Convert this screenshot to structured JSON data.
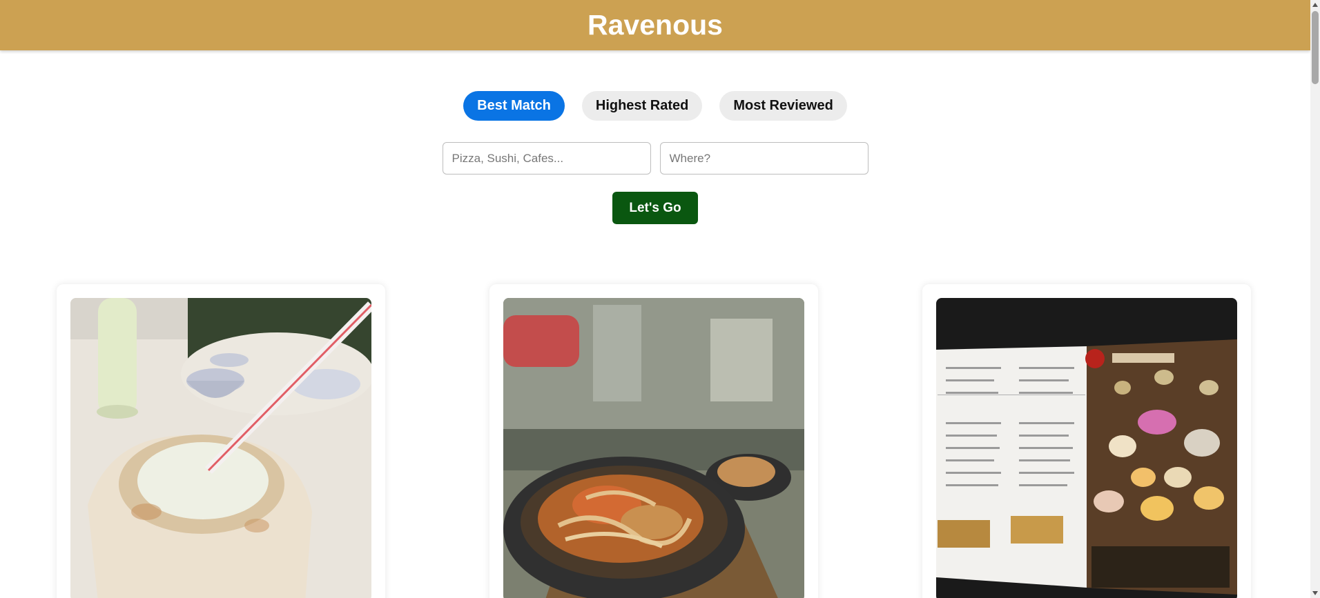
{
  "header": {
    "title": "Ravenous"
  },
  "sort_options": [
    {
      "label": "Best Match",
      "active": true
    },
    {
      "label": "Highest Rated",
      "active": false
    },
    {
      "label": "Most Reviewed",
      "active": false
    }
  ],
  "search": {
    "term_placeholder": "Pizza, Sushi, Cafes...",
    "term_value": "",
    "location_placeholder": "Where?",
    "location_value": "",
    "submit_label": "Let's Go"
  },
  "businesses": [
    {
      "image": "coconut-drink-photo"
    },
    {
      "image": "claypot-noodles-photo"
    },
    {
      "image": "dim-sum-menu-photo"
    }
  ],
  "colors": {
    "header_bg": "#cca152",
    "active_sort": "#0a74e4",
    "submit_button": "#0a5710"
  }
}
